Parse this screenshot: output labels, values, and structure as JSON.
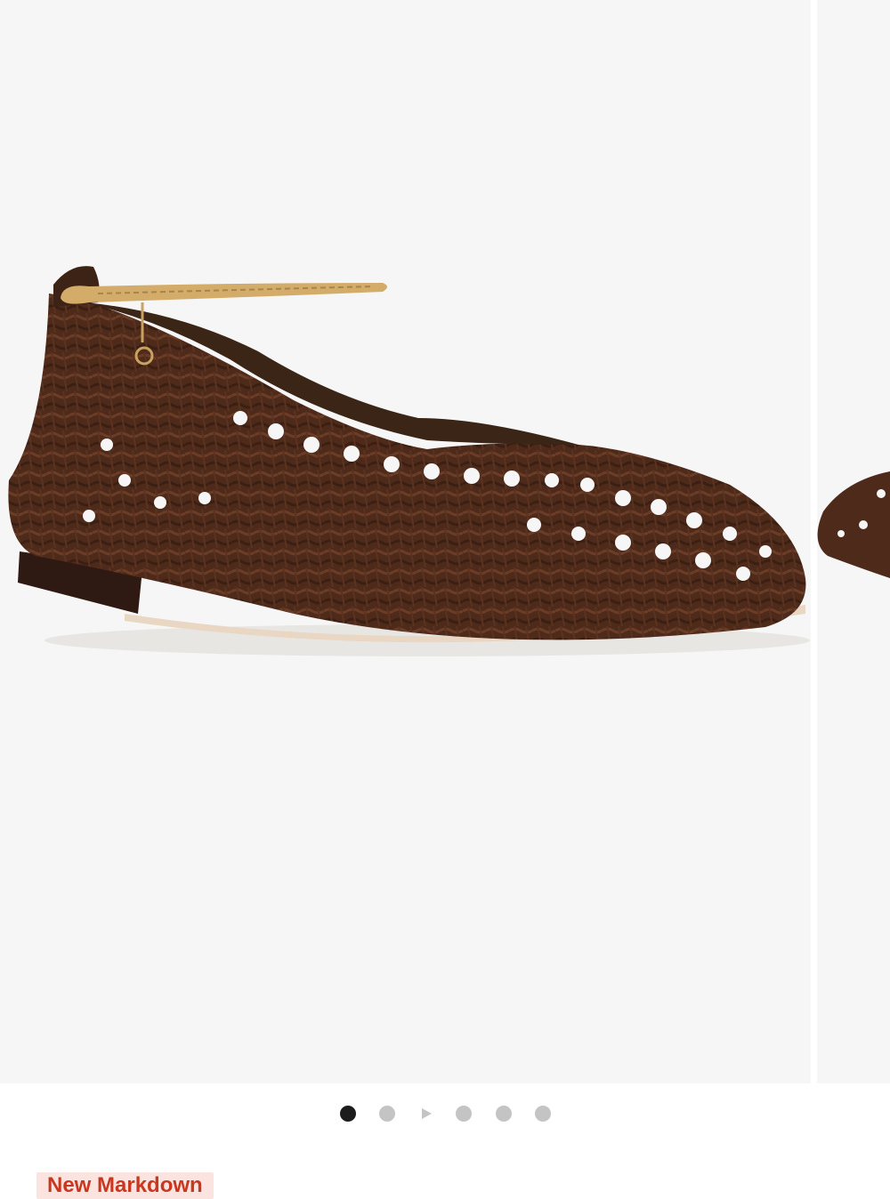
{
  "gallery": {
    "images": [
      {
        "alt": "product-image-woven-ballet-flat"
      },
      {
        "alt": "product-image-next"
      }
    ],
    "dots_total": 6,
    "active_index": 0,
    "video_slide_index": 2
  },
  "badge": {
    "label": "New Markdown"
  },
  "colors": {
    "background": "#f6f6f6",
    "shoe_brown": "#4e2a1a",
    "chain_gold": "#d3ac6a",
    "dot_active": "#1c1c1c",
    "dot_inactive": "#c4c4c4",
    "badge_text": "#c8371f",
    "badge_bg": "#fbe4df"
  }
}
